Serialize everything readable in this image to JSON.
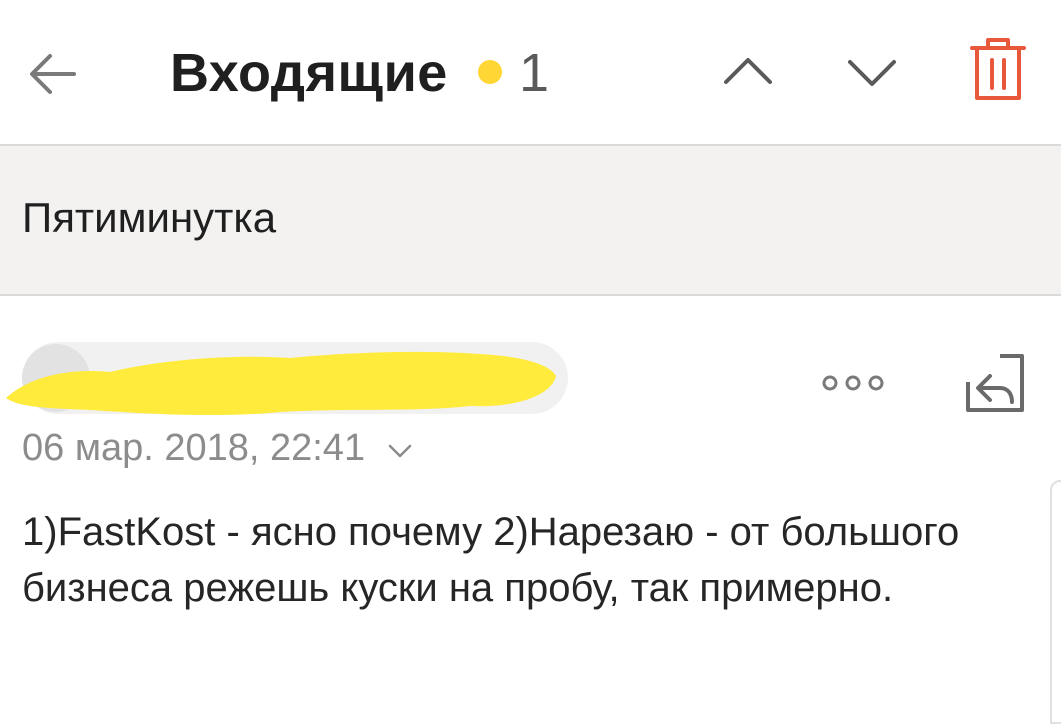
{
  "header": {
    "title": "Входящие",
    "unread_count": "1",
    "unread_dot_color": "#ffd633",
    "icons": {
      "back": "arrow-left-icon",
      "prev": "chevron-up-icon",
      "next": "chevron-down-icon",
      "delete": "trash-icon",
      "delete_color": "#e8593c"
    }
  },
  "message": {
    "subject": "Пятиминутка",
    "sender": {
      "redacted": true,
      "redaction_color": "#ffeb3b"
    },
    "date": "06 мар. 2018, 22:41",
    "actions": {
      "more": "more-dots-icon",
      "reply": "reply-icon"
    },
    "body": "1)FastKost - ясно почему 2)Нарезаю - от большого бизнеса режешь куски на пробу, так примерно."
  }
}
